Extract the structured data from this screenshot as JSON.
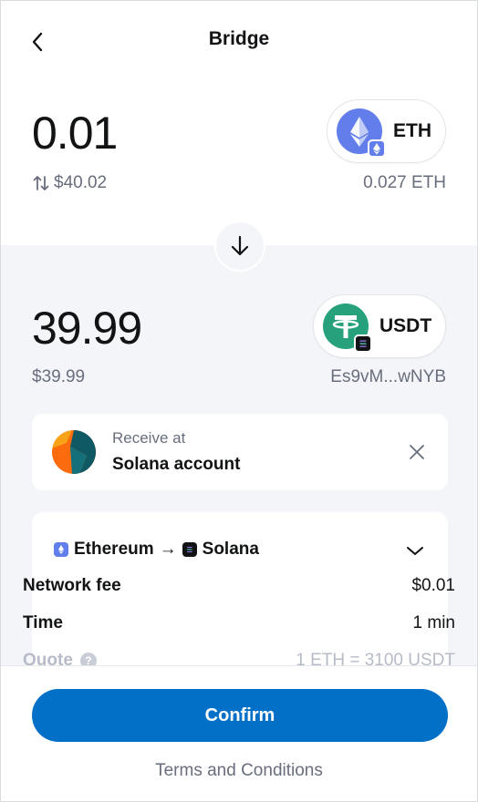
{
  "header": {
    "title": "Bridge"
  },
  "source": {
    "amount": "0.01",
    "fiat_value": "$40.02",
    "token": "ETH",
    "balance": "0.027 ETH"
  },
  "destination": {
    "amount": "39.99",
    "fiat_value": "$39.99",
    "token": "USDT",
    "address": "Es9vM...wNYB"
  },
  "receive": {
    "label": "Receive at",
    "account": "Solana account"
  },
  "route": {
    "from_network": "Ethereum",
    "arrow": "→",
    "to_network": "Solana"
  },
  "details": {
    "network_fee_label": "Network fee",
    "network_fee_value": "$0.01",
    "time_label": "Time",
    "time_value": "1 min",
    "quote_label": "Quote",
    "quote_value": "1 ETH = 3100 USDT"
  },
  "footer": {
    "confirm_label": "Confirm",
    "terms_label": "Terms and Conditions"
  },
  "colors": {
    "primary": "#0370c8",
    "eth": "#627eea",
    "tether": "#26a17b",
    "muted_text": "#686e7d",
    "background": "#f3f5f9"
  },
  "icons": [
    "back-arrow-icon",
    "swap-arrows-icon",
    "eth-icon",
    "usdt-icon",
    "down-arrow-icon",
    "close-icon",
    "chevron-down-icon",
    "help-icon"
  ]
}
